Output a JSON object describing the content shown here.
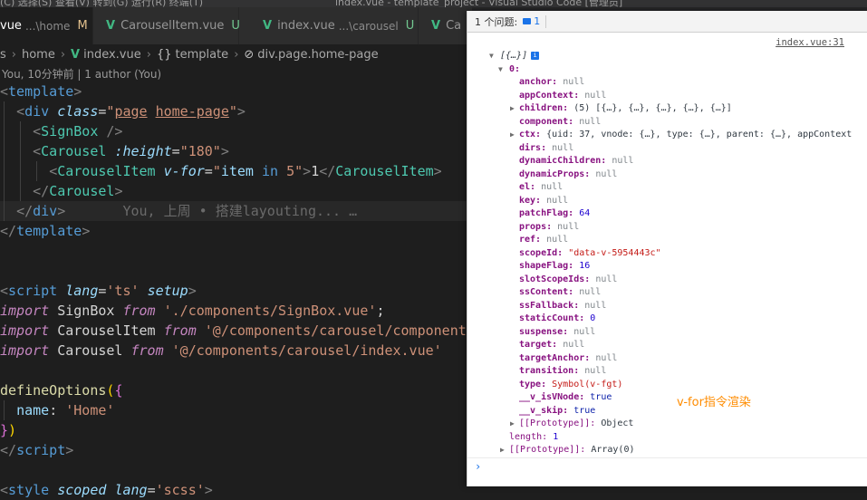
{
  "titlebar": {
    "menu": "(C)   选择(S)   查看(V)   转到(G)   运行(R)   终端(T)",
    "window_title": "index.vue - template_project - Visual Studio Code [管理员]"
  },
  "tabs": [
    {
      "label": "vue",
      "desc": "...\\home",
      "status": "M",
      "close": "×"
    },
    {
      "label": "CarouselItem.vue",
      "status": "U"
    },
    {
      "label": "index.vue",
      "desc": "...\\carousel",
      "status": "U"
    },
    {
      "label": "Ca"
    }
  ],
  "breadcrumb": {
    "items": [
      "s",
      "home",
      "index.vue",
      "template",
      "div.page.home-page"
    ]
  },
  "codelens": "You, 10分钟前 | 1 author (You)",
  "code": {
    "blame": "You, 上周 • 搭建layouting... …"
  },
  "console": {
    "issues_label": "1 个问题:",
    "issues_count": "1",
    "source_link": "index.vue:31",
    "rows": {
      "root": "[{…}]",
      "info": "i",
      "idx0": "0:",
      "anchor_k": "anchor:",
      "anchor_v": "null",
      "appContext_k": "appContext:",
      "appContext_v": "null",
      "children_k": "children:",
      "children_v": "(5) [{…}, {…}, {…}, {…}, {…}]",
      "component_k": "component:",
      "component_v": "null",
      "ctx_k": "ctx:",
      "ctx_v": "{uid: 37, vnode: {…}, type: {…}, parent: {…}, appContext",
      "dirs_k": "dirs:",
      "dirs_v": "null",
      "dynamicChildren_k": "dynamicChildren:",
      "dynamicChildren_v": "null",
      "dynamicProps_k": "dynamicProps:",
      "dynamicProps_v": "null",
      "el_k": "el:",
      "el_v": "null",
      "key_k": "key:",
      "key_v": "null",
      "patchFlag_k": "patchFlag:",
      "patchFlag_v": "64",
      "props_k": "props:",
      "props_v": "null",
      "ref_k": "ref:",
      "ref_v": "null",
      "scopeId_k": "scopeId:",
      "scopeId_v": "\"data-v-5954443c\"",
      "shapeFlag_k": "shapeFlag:",
      "shapeFlag_v": "16",
      "slotScopeIds_k": "slotScopeIds:",
      "slotScopeIds_v": "null",
      "ssContent_k": "ssContent:",
      "ssContent_v": "null",
      "ssFallback_k": "ssFallback:",
      "ssFallback_v": "null",
      "staticCount_k": "staticCount:",
      "staticCount_v": "0",
      "suspense_k": "suspense:",
      "suspense_v": "null",
      "target_k": "target:",
      "target_v": "null",
      "targetAnchor_k": "targetAnchor:",
      "targetAnchor_v": "null",
      "transition_k": "transition:",
      "transition_v": "null",
      "type_k": "type:",
      "type_v": "Symbol(v-fgt)",
      "isVNode_k": "__v_isVNode:",
      "isVNode_v": "true",
      "skip_k": "__v_skip:",
      "skip_v": "true",
      "proto1_k": "[[Prototype]]:",
      "proto1_v": "Object",
      "length_k": "length:",
      "length_v": "1",
      "proto2_k": "[[Prototype]]:",
      "proto2_v": "Array(0)"
    },
    "annotation": "v-for指令渲染",
    "prompt": "›"
  },
  "colors": {
    "editor_bg": "#1e1e1e",
    "vue_green": "#41b883",
    "annotation_orange": "#ff8c00",
    "console_key": "#881280"
  }
}
